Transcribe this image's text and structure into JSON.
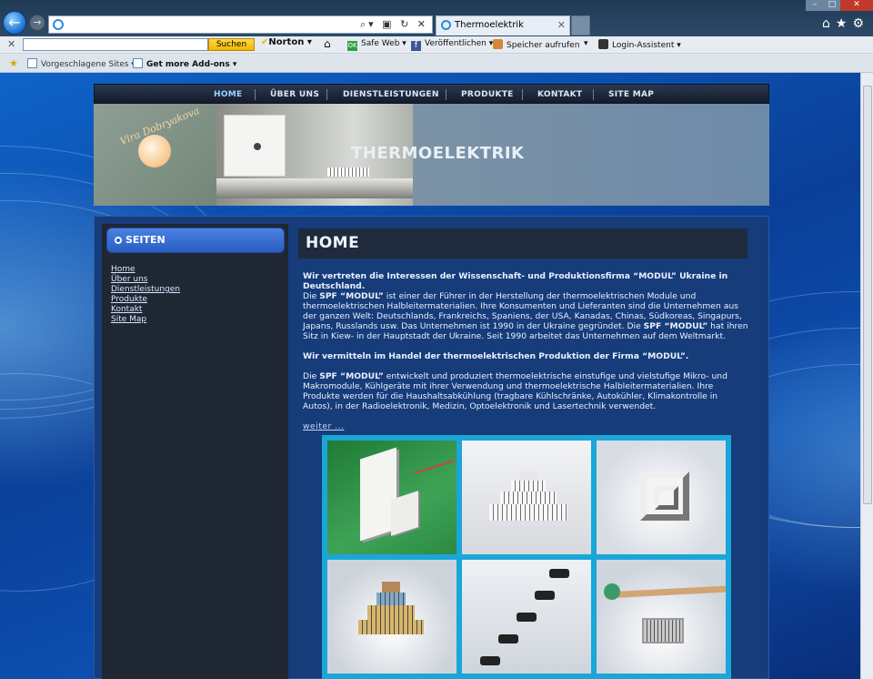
{
  "browser": {
    "address_value": "",
    "tab_label": "Thermoelektrik",
    "window_controls": {
      "minimize": "–",
      "maximize": "□",
      "close": "✕"
    },
    "right_tools": [
      "home-icon",
      "star-icon",
      "gear-icon"
    ]
  },
  "toolbar": {
    "search_value": "",
    "search_button": "Suchen",
    "norton": "Norton",
    "safe_web": "Safe Web",
    "publish": "Veröffentlichen",
    "save_call": "Speicher aufrufen",
    "login_assistant": "Login-Assistent"
  },
  "favorites": {
    "suggested": "Vorgeschlagene Sites",
    "addons": "Get more Add-ons"
  },
  "site": {
    "nav": [
      "HOME",
      "ÜBER UNS",
      "DIENSTLEISTUNGEN",
      "PRODUKTE",
      "KONTAKT",
      "SITE MAP"
    ],
    "logo_text": "Vira Dobryakova",
    "header_title": "THERMOELEKTRIK",
    "sidebar_title": "SEITEN",
    "sidebar_links": [
      "Home",
      "Über uns",
      "Dienstleistungen",
      "Produkte",
      "Kontakt",
      "Site Map"
    ],
    "page_title": "HOME",
    "intro_heading": "Wir vertreten die Interessen der Wissenschaft- und Produktionsfirma “MODUL” Ukraine in Deutschland.",
    "p1_a": "Die ",
    "p1_b": "SPF “MODUL”",
    "p1_c": " ist einer der Führer in der Herstellung der thermoelektrischen Module und thermoelektrischen Halbleitermaterialien. Ihre Konsumenten und Lieferanten sind die Unternehmen aus der ganzen Welt: Deutschlands, Frankreichs, Spaniens, der USA, Kanadas, Chinas, Südkoreas, Singapurs, Japans, Russlands usw. Das Unternehmen ist 1990 in der Ukraine gegründet. Die ",
    "p1_d": "SPF “MODUL”",
    "p1_e": " hat ihren Sitz in Kiew- in der Hauptstadt der Ukraine. Seit 1990 arbeitet das Unternehmen auf dem Weltmarkt.",
    "trade_heading": "Wir vermitteln im Handel der thermoelektrischen Produktion der Firma “MODUL”.",
    "p2_a": "Die ",
    "p2_b": "SPF “MODUL”",
    "p2_c": " entwickelt und produziert thermoelektrische einstufige und vielstufige Mikro- und Makromodule, Kühlgeräte mit ihrer Verwendung und thermoelektrische Halbleitermaterialien. Ihre Produkte werden für die Haushaltsabkühlung (tragbare Kühlschränke, Autokühler, Klimakontrolle in Autos), in der Radioelektronik, Medizin, Optoelektronik und Lasertechnik verwendet.",
    "more_link": "weiter ..."
  },
  "colors": {
    "nav_active": "#9fd3ff",
    "gallery_frame": "#1aa6d8",
    "sidebar_header": "#2a5cc2"
  }
}
